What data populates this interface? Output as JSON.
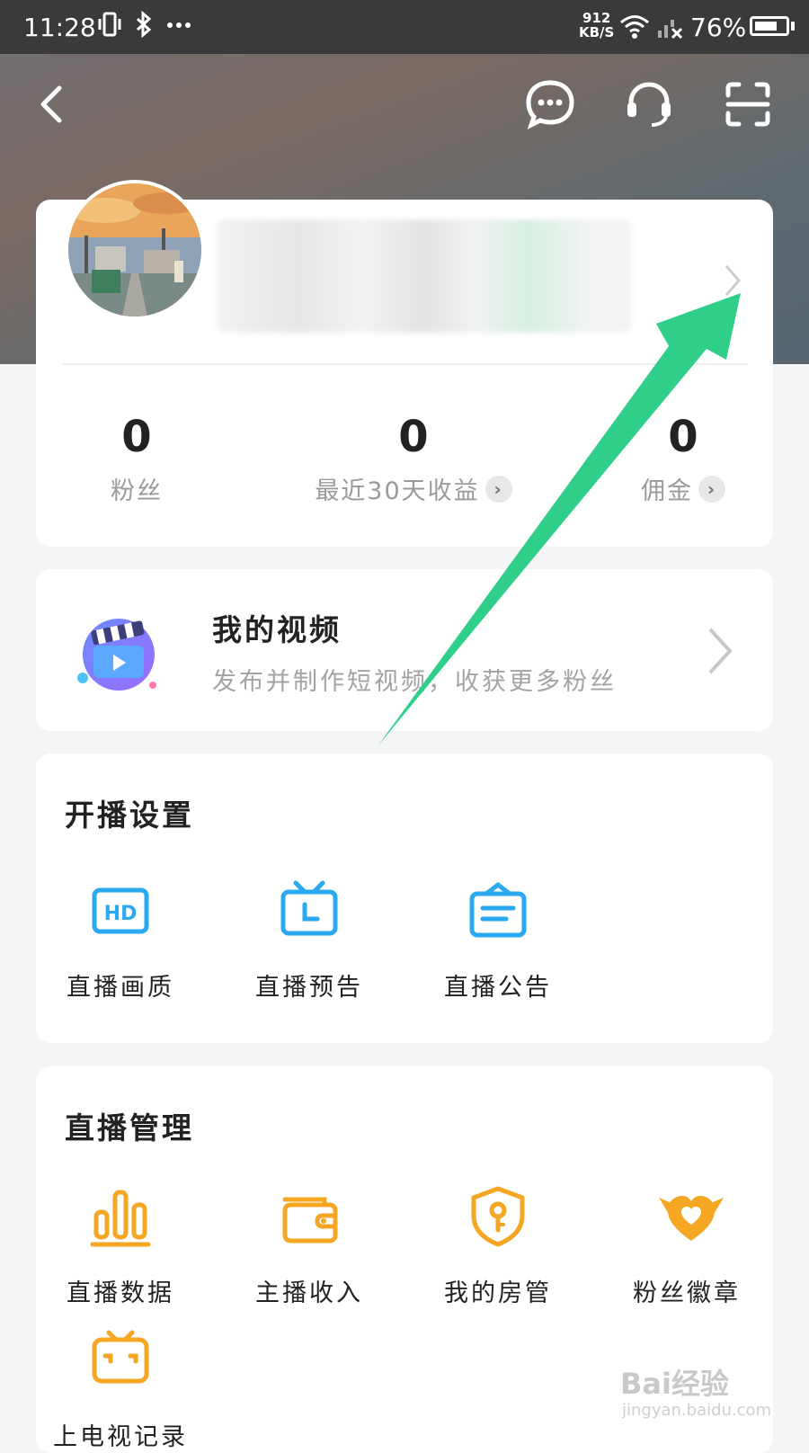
{
  "status_bar": {
    "time": "11:28",
    "speed_value": "912",
    "speed_unit": "KB/S",
    "battery_percent": "76%",
    "battery_level": 0.76
  },
  "nav": {
    "icons": [
      "back-icon",
      "message-icon",
      "customer-service-icon",
      "scan-icon"
    ]
  },
  "stats": [
    {
      "value": "0",
      "label": "粉丝"
    },
    {
      "value": "0",
      "label": "最近30天收益"
    },
    {
      "value": "0",
      "label": "佣金"
    }
  ],
  "video": {
    "title": "我的视频",
    "subtitle": "发布并制作短视频，收获更多粉丝"
  },
  "settings": {
    "title": "开播设置",
    "items": [
      {
        "label": "直播画质",
        "icon": "hd-icon"
      },
      {
        "label": "直播预告",
        "icon": "tv-clock-icon"
      },
      {
        "label": "直播公告",
        "icon": "notice-icon"
      }
    ]
  },
  "manage": {
    "title": "直播管理",
    "items": [
      {
        "label": "直播数据",
        "icon": "bar-chart-icon"
      },
      {
        "label": "主播收入",
        "icon": "wallet-icon"
      },
      {
        "label": "我的房管",
        "icon": "shield-key-icon"
      },
      {
        "label": "粉丝徽章",
        "icon": "heart-badge-icon"
      },
      {
        "label": "上电视记录",
        "icon": "tv-face-icon"
      }
    ]
  },
  "watermark": {
    "text": "Bai经验",
    "sub": "jingyan.baidu.com"
  },
  "colors": {
    "accent_blue": "#2aa8f0",
    "accent_orange": "#f5a623",
    "arrow_green": "#2fcf8a"
  }
}
